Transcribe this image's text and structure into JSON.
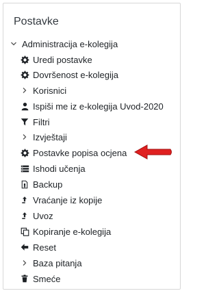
{
  "block": {
    "title": "Postavke"
  },
  "tree": {
    "root_label": "Administracija e-kolegija",
    "items": [
      {
        "label": "Uredi postavke",
        "icon": "gear-icon"
      },
      {
        "label": "Dovršenost e-kolegija",
        "icon": "gear-icon"
      },
      {
        "label": "Korisnici",
        "icon": "chevron-right-icon"
      },
      {
        "label": "Ispiši me iz e-kolegija Uvod-2020",
        "icon": "user-icon"
      },
      {
        "label": "Filtri",
        "icon": "filter-icon"
      },
      {
        "label": "Izvještaji",
        "icon": "chevron-right-icon"
      },
      {
        "label": "Postavke popisa ocjena",
        "icon": "gear-icon"
      },
      {
        "label": "Ishodi učenja",
        "icon": "list-icon"
      },
      {
        "label": "Backup",
        "icon": "archive-icon"
      },
      {
        "label": "Vraćanje iz kopije",
        "icon": "restore-icon"
      },
      {
        "label": "Uvoz",
        "icon": "import-icon"
      },
      {
        "label": "Kopiranje e-kolegija",
        "icon": "copy-icon"
      },
      {
        "label": "Reset",
        "icon": "arrow-left-icon"
      },
      {
        "label": "Baza pitanja",
        "icon": "chevron-right-icon"
      },
      {
        "label": "Smeće",
        "icon": "trash-icon"
      }
    ]
  },
  "annotation": {
    "arrow_color": "#e02020"
  }
}
